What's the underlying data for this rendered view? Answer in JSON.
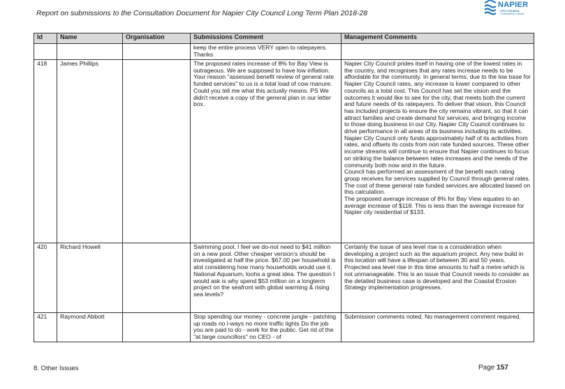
{
  "header": {
    "title": "Report on submissions to the Consultation Document for Napier City Council Long Term Plan 2018-28"
  },
  "logo": {
    "name": "NAPIER",
    "sub": "CITY COUNCIL",
    "tagline": "Te Kaunihera o Ahuriri",
    "color": "#1b75bb"
  },
  "table": {
    "headers": [
      "Id",
      "Name",
      "Organisation",
      "Submissions Comment",
      "Management Comments"
    ],
    "rows": [
      {
        "id": "",
        "name": "",
        "organisation": "",
        "comment": "keep the entire process VERY open to ratepayers. Thanks",
        "management": ""
      },
      {
        "id": "418",
        "name": "James Phillips",
        "organisation": "",
        "comment": "The proposed rates increase of 8% for Bay View is outrageous. We are supposed to have low inflation. Your reason \"assessed benefit review of general rate funded services\" to us is a total load of cow manure. Could you tell me what this actually means. PS We didn't receive a copy of the general plan in our letter box.",
        "management_paragraphs": [
          "Napier City Council prides itself in having one of the lowest rates in the country, and recognises that any rates increase needs to be affordable for the community. In general terms, due to the low base for Napier City Council rates, any increase is lower compared to other councils as a total cost. This Council has set the vision and the outcomes it would like to see for the city, that meets both the current and future needs of its ratepayers. To deliver that vision, this Council has included projects to ensure the city remains vibrant, so that it can attract families and create demand for services, and bringing income to those doing business in our City. Napier City Council continues to drive performance in all areas of its business including its activities. Napier City Council only funds approximately half of its activities from rates, and offsets its costs from non rate funded sources. These other income streams will continue to ensure that Napier continues to focus on striking the balance between rates increases and the needs of the community both now and in the future.",
          "Council has performed an assessment of the benefit each rating group receives for services supplied by Council through general rates. The cost of these general rate funded services are allocated based on this calculation.",
          "The proposed average increase of 8% for Bay View equates to an average increase of $118. This is less than the average increase for Napier city residential of $133."
        ]
      },
      {
        "id": "420",
        "name": "Richard Howell",
        "organisation": "",
        "comment": "Swimming pool, I feel we do-not need to $41 million on a new pool. Other cheaper version's should be investigated at half the price. $67.00 per household is alot considering how many households would use it. National Aquarium, loohs a great idea. The question I would ask is why spend $53 million on a longterm project on the seafront with global warming & rising sea levels?",
        "management": "Certainly the issue of sea level rise is a consideration when developing a project such as the aquarium project. Any new build in this location will have a lifespan of between 30 and 50 years. Projected sea level rise in this time amounts to half a metre which is not unmanageable. This is an issue that Council needs to consider as the detailed business case is developed and the Coastal Erosion Strategy implementation progresses."
      },
      {
        "id": "421",
        "name": "Raymond Abbott",
        "organisation": "",
        "comment": "Stop spending our money - concrete jungle - patching up roads no i-ways no more traffic lights Do the job you are paid to do - work for the public. Get rid of the \"at large councillors\" no CEO - of",
        "management": "Submission comments noted. No management comment required."
      }
    ]
  },
  "footer": {
    "section": "8. Other Issues",
    "page_label": "Page",
    "page_number": "157"
  }
}
